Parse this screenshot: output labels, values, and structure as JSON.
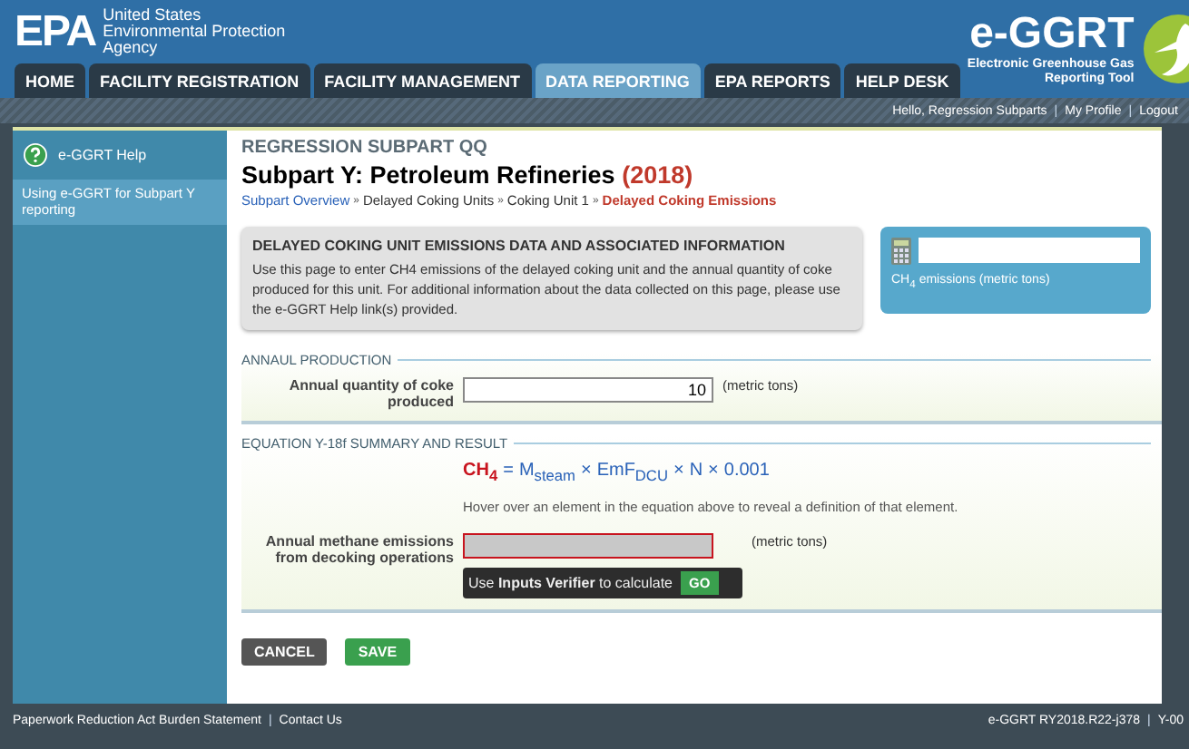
{
  "header": {
    "agency_logo": "EPA",
    "agency_name": [
      "United States",
      "Environmental Protection",
      "Agency"
    ],
    "tool_logo": "e-GGRT",
    "tool_name": "Electronic Greenhouse Gas Reporting Tool"
  },
  "tabs": [
    {
      "label": "HOME",
      "selected": false
    },
    {
      "label": "FACILITY REGISTRATION",
      "selected": false
    },
    {
      "label": "FACILITY MANAGEMENT",
      "selected": false
    },
    {
      "label": "DATA REPORTING",
      "selected": true
    },
    {
      "label": "EPA REPORTS",
      "selected": false
    },
    {
      "label": "HELP DESK",
      "selected": false
    }
  ],
  "user_bar": {
    "separator": "|",
    "items": [
      "Hello, Regression Subparts",
      "My Profile",
      "Logout"
    ]
  },
  "sidebar": {
    "title": "e-GGRT Help",
    "items": [
      {
        "label": "Using e-GGRT for Subpart Y reporting",
        "selected": true
      }
    ]
  },
  "page": {
    "supertitle": "REGRESSION SUBPART QQ",
    "title": "Subpart Y: Petroleum Refineries",
    "year": "(2018)",
    "breadcrumb": {
      "separator": "»",
      "items": [
        {
          "label": "Subpart Overview",
          "kind": "link"
        },
        {
          "label": "Delayed Coking Units",
          "kind": "plain"
        },
        {
          "label": "Coking Unit 1",
          "kind": "plain"
        },
        {
          "label": "Delayed Coking Emissions",
          "kind": "current"
        }
      ]
    }
  },
  "info_box": {
    "title": "DELAYED COKING UNIT EMISSIONS DATA AND ASSOCIATED INFORMATION",
    "text": "Use this page to enter CH4 emissions of the delayed coking unit and the annual quantity of coke produced for this unit. For additional information about the data collected on this page, please use the e-GGRT Help link(s) provided."
  },
  "calculator": {
    "label": "CH$_{4}$ emissions (metric tons)"
  },
  "production": {
    "heading": "ANNAUL PRODUCTION",
    "label": "Annual quantity of coke produced",
    "value": "10",
    "unit": "(metric tons)"
  },
  "equation": {
    "heading": "EQUATION Y-18f SUMMARY AND RESULT",
    "lhs": "CH$_{4}$",
    "equals": "=",
    "rhs": [
      "M$_{steam}$",
      "×",
      "EmF$_{DCU}$",
      "×",
      "N",
      "×",
      "0.001"
    ],
    "hint": "Hover over an element in the equation above to reveal a definition of that element."
  },
  "result": {
    "label": "Annual methane emissions from decoking operations",
    "invalid": true,
    "disabled": true,
    "unit": "(metric tons)",
    "tooltip": "Use **Inputs Verifier** to calculate",
    "go": "GO"
  },
  "buttons": {
    "cancel": "CANCEL",
    "save": "SAVE"
  },
  "footer": {
    "separator": "|",
    "left": [
      "Paperwork Reduction Act Burden Statement",
      "Contact Us"
    ],
    "right": [
      "e-GGRT RY2018.R22-j378",
      "Y-00"
    ]
  }
}
